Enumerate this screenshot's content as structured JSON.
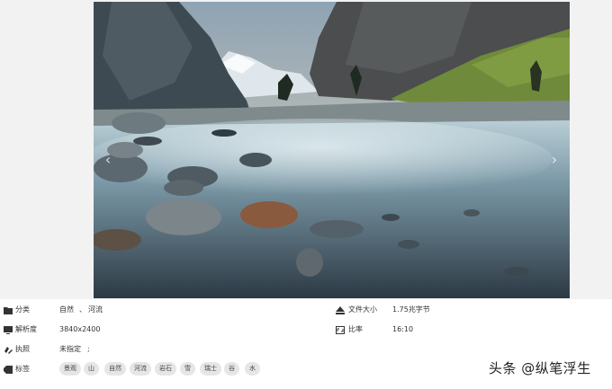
{
  "info": {
    "category": {
      "label": "分类",
      "values": [
        "自然",
        "河流"
      ],
      "separator": "、"
    },
    "resolution": {
      "label": "解析度",
      "value": "3840x2400"
    },
    "license": {
      "label": "执照",
      "value": "未指定",
      "extra": ";"
    },
    "tags": {
      "label": "标签",
      "items": [
        "景观",
        "山",
        "自然",
        "河流",
        "岩石",
        "雪",
        "瑞士",
        "谷",
        "水"
      ]
    },
    "filesize": {
      "label": "文件大小",
      "value": "1.75兆字节"
    },
    "ratio": {
      "label": "比率",
      "value": "16:10"
    }
  },
  "viewer": {
    "prev_arrow": "‹",
    "next_arrow": "›"
  },
  "watermark": "头条 @纵笔浮生"
}
